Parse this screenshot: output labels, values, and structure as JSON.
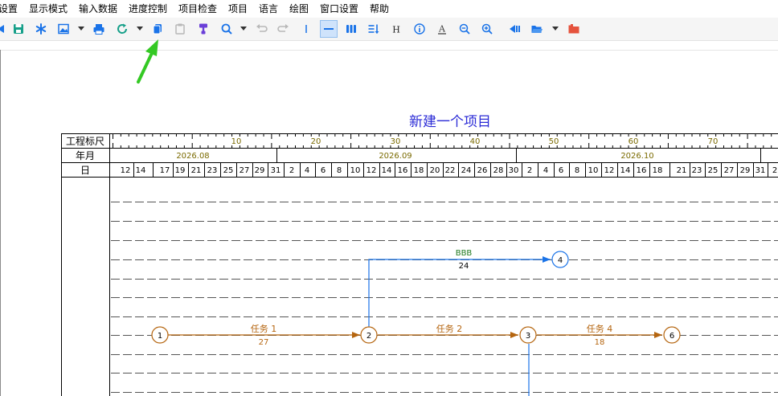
{
  "menu": [
    "设置",
    "显示模式",
    "输入数据",
    "进度控制",
    "项目检查",
    "项目",
    "语言",
    "绘图",
    "窗口设置",
    "帮助"
  ],
  "toolbar_icons": [
    "nav-arrow-icon",
    "save-icon",
    "asterisk-icon",
    "image-export-icon",
    "print-icon",
    "refresh-icon",
    "copy-icon",
    "paste-icon",
    "format-brush-icon",
    "zoom-search-icon",
    "undo-icon",
    "redo-icon",
    "vertical-line-icon",
    "horizontal-line-icon",
    "bar-columns-icon",
    "list-sort-icon",
    "heading-h-icon",
    "info-icon",
    "text-underline-icon",
    "zoom-out-icon",
    "zoom-in-icon",
    "back-arrow-icon",
    "open-folder-icon",
    "red-folder-icon"
  ],
  "colors": {
    "brown": "#b5650f",
    "blue": "#1a73e8",
    "olive": "#7a6a00",
    "title": "#2b2bd6",
    "green_arrow": "#34c924"
  },
  "title": "新建一个项目",
  "timescale": {
    "row_labels": [
      "工程标尺",
      "年月",
      "日"
    ],
    "ruler_numbers": [
      "10",
      "20",
      "30",
      "40",
      "50",
      "60",
      "70"
    ],
    "months": [
      "2026.08",
      "2026.09",
      "2026.10"
    ],
    "days": [
      "12",
      "14",
      "17",
      "19",
      "21",
      "23",
      "25",
      "27",
      "29",
      "31",
      "2",
      "4",
      "6",
      "8",
      "10",
      "12",
      "14",
      "16",
      "18",
      "20",
      "22",
      "24",
      "26",
      "28",
      "30",
      "2",
      "4",
      "6",
      "8",
      "10",
      "12",
      "14",
      "16",
      "18",
      "21",
      "23",
      "25",
      "27",
      "29",
      "31",
      "2"
    ]
  },
  "network": {
    "nodes": [
      "1",
      "2",
      "3",
      "4",
      "6"
    ],
    "tasks": [
      {
        "name": "任务 1",
        "duration": "27"
      },
      {
        "name": "任务 2",
        "duration": ""
      },
      {
        "name": "任务 4",
        "duration": "18"
      },
      {
        "name": "BBB",
        "duration": "24"
      }
    ]
  }
}
